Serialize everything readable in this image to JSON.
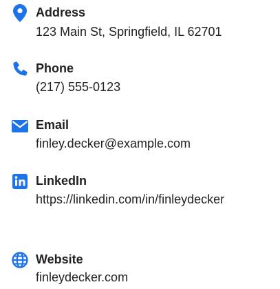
{
  "accent_color": "#1e73e8",
  "contacts": [
    {
      "icon": "map-pin-icon",
      "label": "Address",
      "value": "123 Main St, Springfield, IL 62701"
    },
    {
      "icon": "phone-icon",
      "label": "Phone",
      "value": "(217) 555-0123"
    },
    {
      "icon": "envelope-icon",
      "label": "Email",
      "value": "finley.decker@example.com"
    },
    {
      "icon": "linkedin-icon",
      "label": "LinkedIn",
      "value": "https://linkedin.com/in/finleydecker"
    },
    {
      "icon": "globe-icon",
      "label": "Website",
      "value": "finleydecker.com"
    }
  ]
}
